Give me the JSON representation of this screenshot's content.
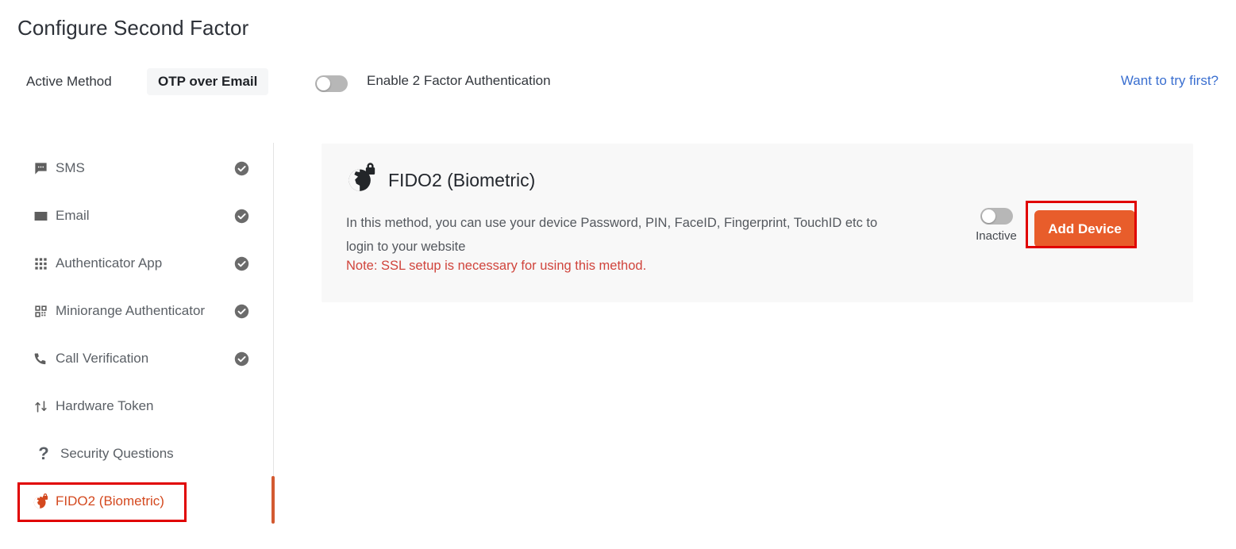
{
  "page": {
    "title": "Configure Second Factor"
  },
  "header": {
    "active_method_label": "Active Method",
    "active_method_value": "OTP over Email",
    "enable_toggle_label": "Enable 2 Factor Authentication",
    "enable_toggle_state": "off",
    "try_first_link": "Want to try first?",
    "link_color": "#3a6fd0"
  },
  "sidebar": {
    "items": [
      {
        "label": "SMS",
        "icon": "chat-bubble-icon",
        "configured": true,
        "active": false
      },
      {
        "label": "Email",
        "icon": "envelope-icon",
        "configured": true,
        "active": false
      },
      {
        "label": "Authenticator App",
        "icon": "dot-grid-icon",
        "configured": true,
        "active": false
      },
      {
        "label": "Miniorange Authenticator",
        "icon": "qr-code-icon",
        "configured": true,
        "active": false
      },
      {
        "label": "Call Verification",
        "icon": "phone-icon",
        "configured": true,
        "active": false
      },
      {
        "label": "Hardware Token",
        "icon": "exchange-arrows-icon",
        "configured": false,
        "active": false
      },
      {
        "label": "Security Questions",
        "icon": "question-mark-icon",
        "configured": false,
        "active": false
      },
      {
        "label": "FIDO2 (Biometric)",
        "icon": "globe-lock-icon",
        "configured": false,
        "active": true
      }
    ],
    "active_color": "#d4491f",
    "check_badge_color": "#6b6b6b"
  },
  "card": {
    "icon": "globe-lock-icon",
    "title": "FIDO2 (Biometric)",
    "description": "In this method, you can use your device Password, PIN, FaceID, Fingerprint, TouchID etc to login to your website",
    "note": "Note: SSL setup is necessary for using this method.",
    "note_color": "#d0443c",
    "status_label": "Inactive",
    "status_toggle_state": "off",
    "add_device_label": "Add Device",
    "add_device_color": "#e85d2b"
  },
  "annotations": {
    "highlight_color": "#e00000",
    "boxes": [
      "sidebar-fido2-item",
      "add-device-button"
    ]
  }
}
